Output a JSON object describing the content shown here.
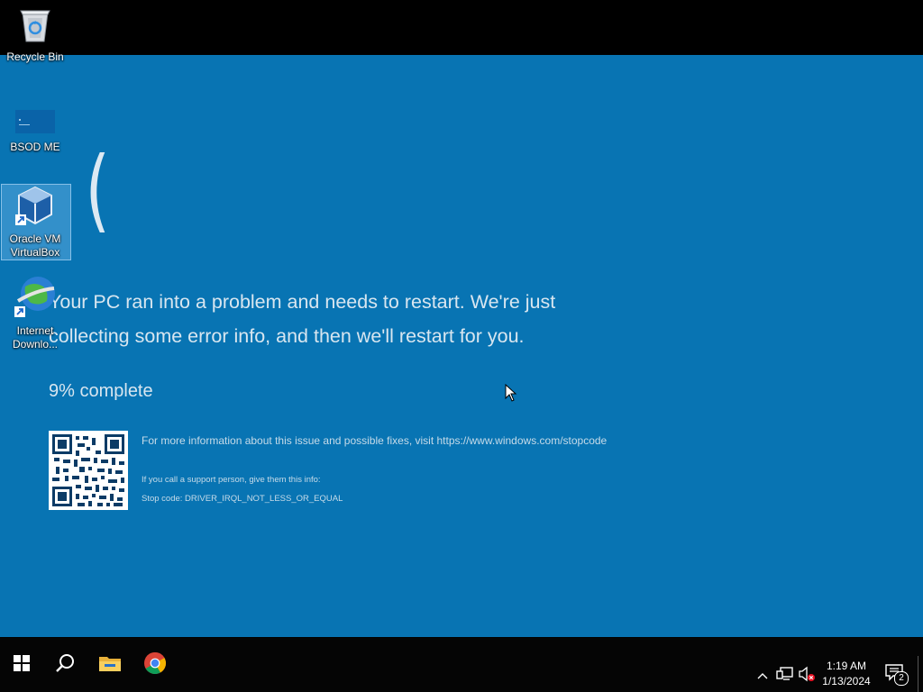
{
  "desktop": {
    "icons": [
      {
        "label": "Recycle Bin",
        "icon": "recycle-bin-icon"
      },
      {
        "label": "BSOD ME",
        "icon": "bsod-shortcut-icon"
      },
      {
        "label": "Oracle VM VirtualBox",
        "icon": "virtualbox-icon"
      },
      {
        "label": "Internet Downlo...",
        "icon": "internet-download-manager-icon"
      }
    ]
  },
  "bsod": {
    "frown": "(",
    "message": "Your PC ran into a problem and needs to restart. We're just collecting some error info, and then we'll restart for you.",
    "progress": "9% complete",
    "more_info": "For more information about this issue and possible fixes, visit https://www.windows.com/stopcode",
    "support": "If you call a support person, give them this info:",
    "stop_code": "Stop code: DRIVER_IRQL_NOT_LESS_OR_EQUAL",
    "background": "#0874b3"
  },
  "taskbar": {
    "buttons": [
      "start-icon",
      "search-icon",
      "file-explorer-icon",
      "chrome-icon"
    ],
    "tray": {
      "time": "1:19 AM",
      "date": "1/13/2024",
      "notifications": "2"
    }
  }
}
